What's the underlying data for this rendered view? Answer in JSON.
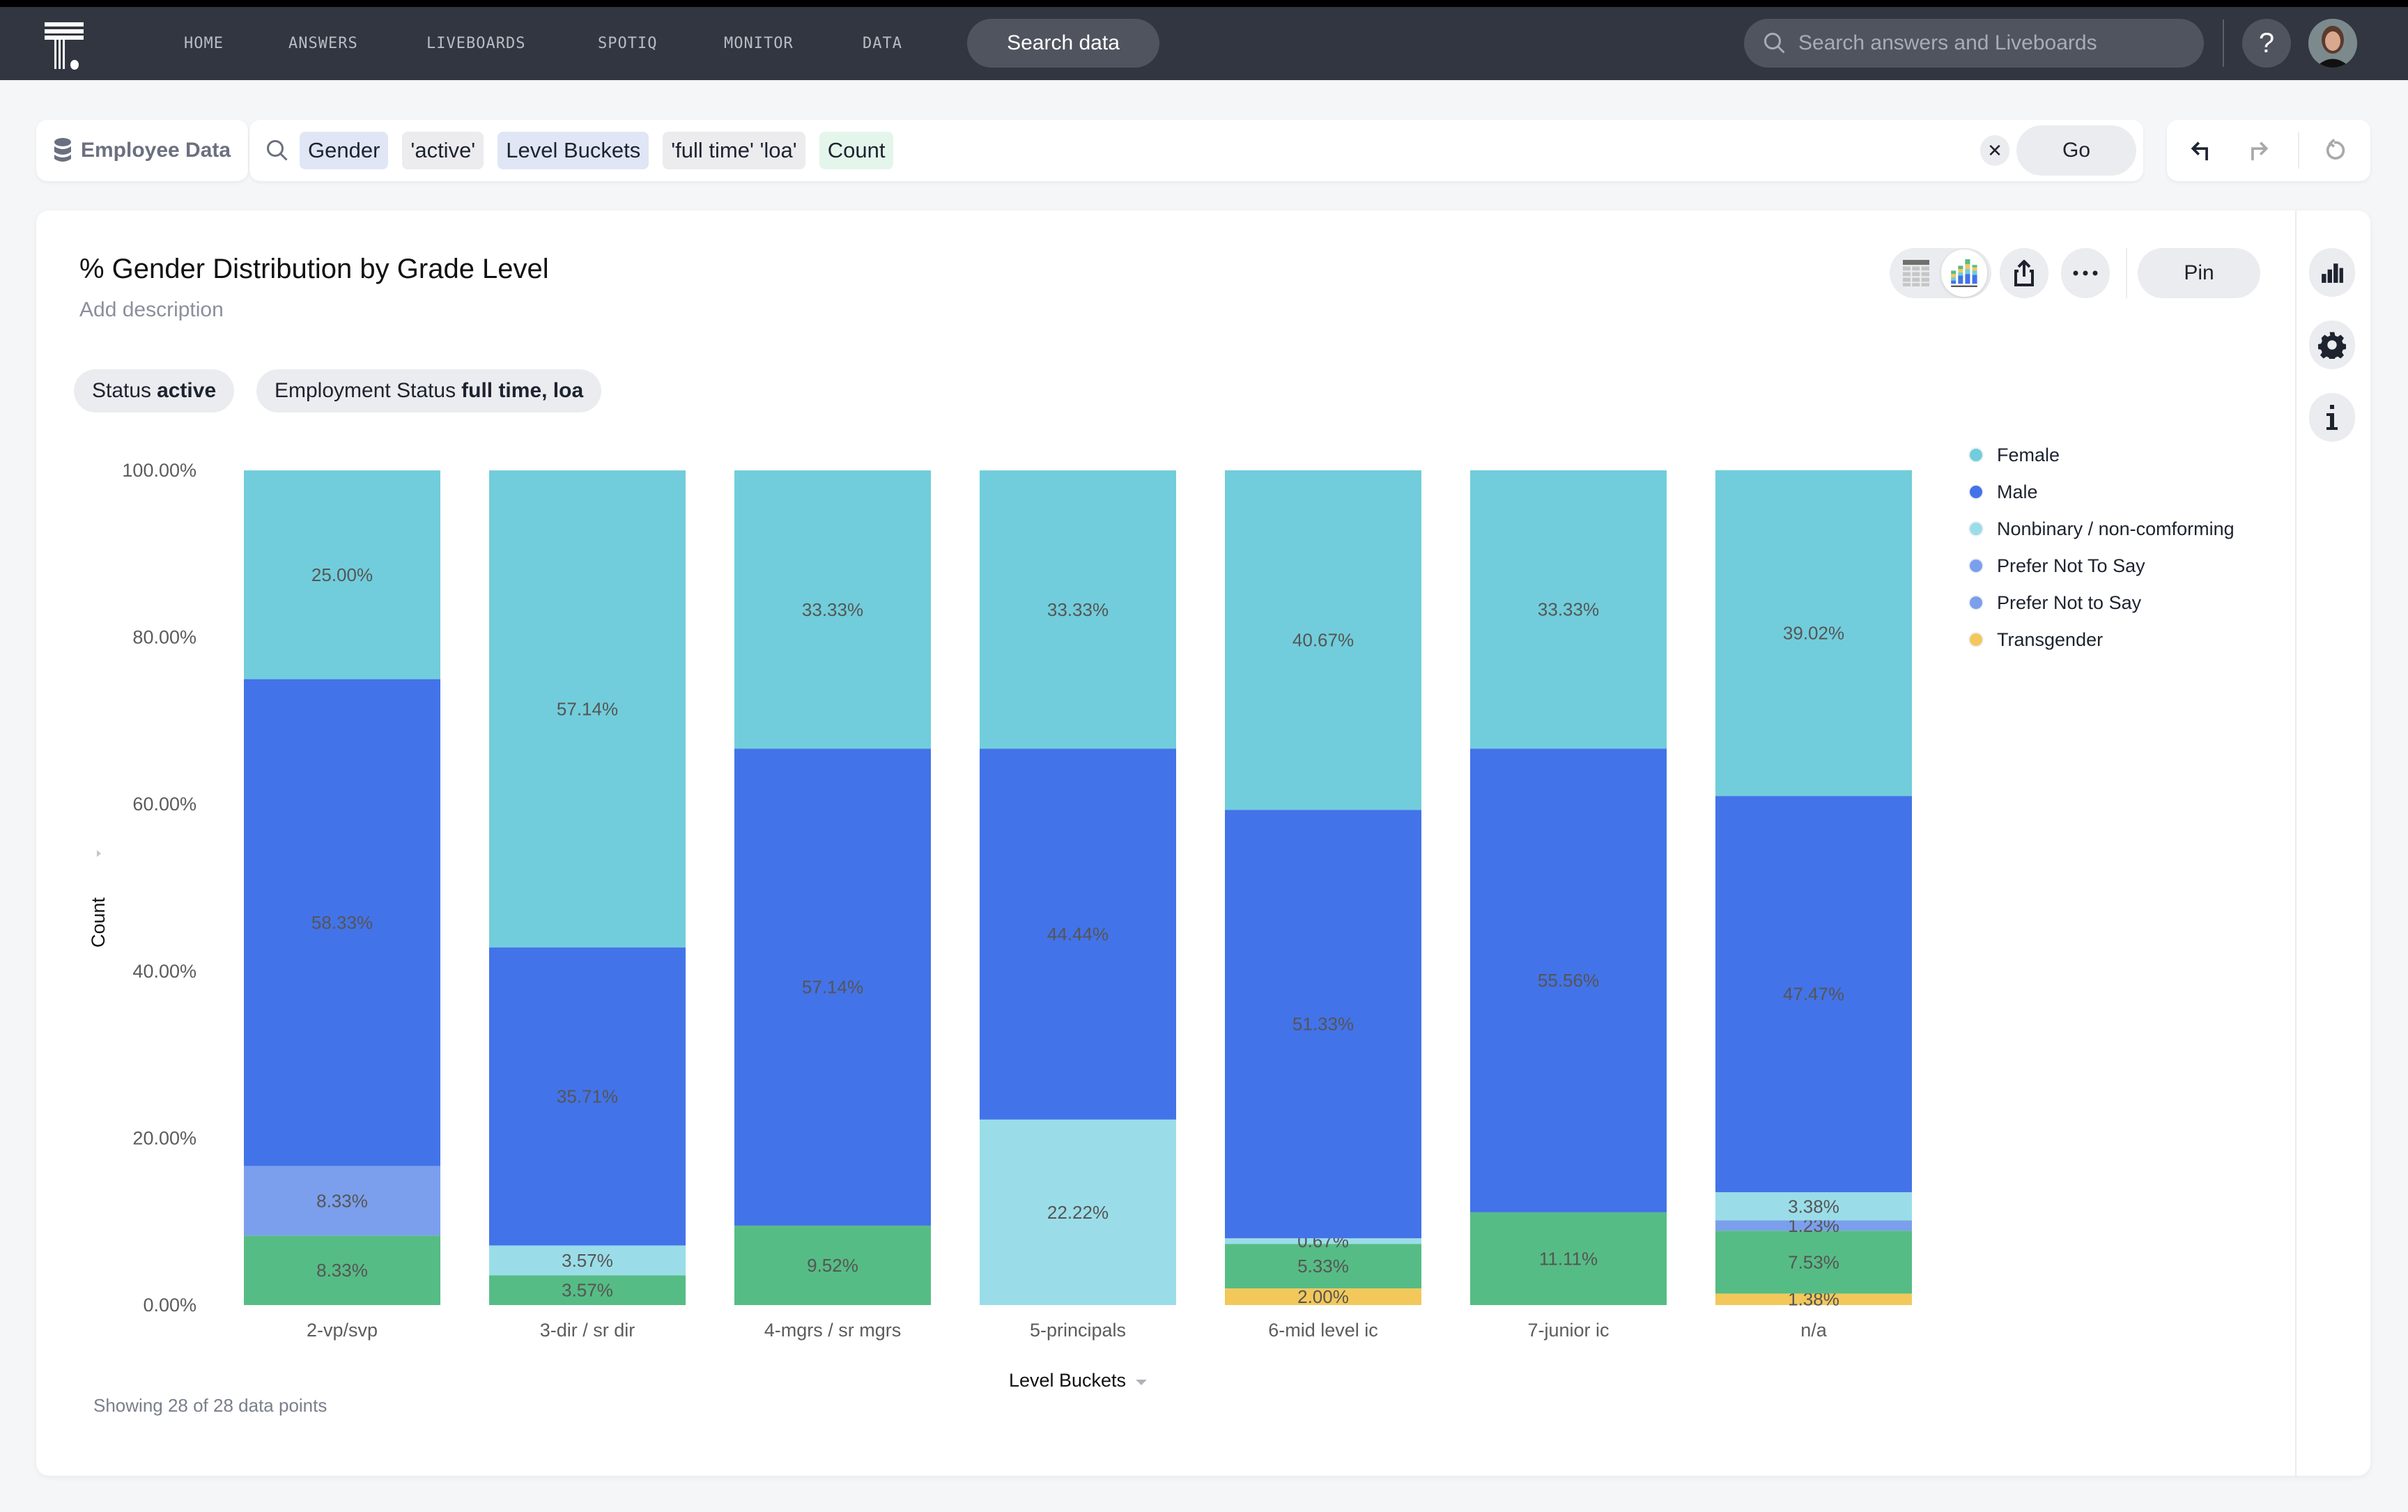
{
  "nav": {
    "items": [
      "HOME",
      "ANSWERS",
      "LIVEBOARDS",
      "SPOTIQ",
      "MONITOR",
      "DATA"
    ],
    "search_data_label": "Search data",
    "global_search_placeholder": "Search answers and Liveboards",
    "help_label": "?"
  },
  "search_bar": {
    "datasource": "Employee Data",
    "tokens": [
      {
        "text": "Gender",
        "kind": "attr"
      },
      {
        "text": "'active'",
        "kind": "val"
      },
      {
        "text": "Level Buckets",
        "kind": "attr"
      },
      {
        "text": "'full time' 'loa'",
        "kind": "val"
      },
      {
        "text": "Count",
        "kind": "measure"
      }
    ],
    "clear_label": "✕",
    "go_label": "Go"
  },
  "answer": {
    "title": "% Gender Distribution by Grade Level",
    "description_placeholder": "Add description",
    "filters": [
      {
        "name": "Status",
        "value": "active"
      },
      {
        "name": "Employment Status",
        "value": "full time, loa"
      }
    ],
    "pin_label": "Pin",
    "footer": "Showing 28 of 28 data points"
  },
  "chart_data": {
    "type": "bar",
    "stacked": "percent",
    "title": "% Gender Distribution by Grade Level",
    "xlabel": "Level Buckets",
    "ylabel": "Count",
    "ylim": [
      0,
      100
    ],
    "yticks": [
      "0.00%",
      "20.00%",
      "40.00%",
      "60.00%",
      "80.00%",
      "100.00%"
    ],
    "categories": [
      "2-vp/svp",
      "3-dir / sr dir",
      "4-mgrs / sr mgrs",
      "5-principals",
      "6-mid level ic",
      "7-junior ic",
      "n/a"
    ],
    "series": [
      {
        "name": "Transgender",
        "color": "#f2c85b",
        "values": [
          0,
          0,
          0,
          0,
          2.0,
          0,
          1.38
        ]
      },
      {
        "name": "Prefer Not to Say",
        "color": "#56bc85",
        "values": [
          8.33,
          3.57,
          9.52,
          0,
          5.33,
          11.11,
          7.53
        ]
      },
      {
        "name": "Prefer Not To Say",
        "color": "#7b9fec",
        "values": [
          8.33,
          0,
          0,
          0,
          0,
          0,
          1.23
        ]
      },
      {
        "name": "Nonbinary / non-comforming",
        "color": "#9adde8",
        "values": [
          0,
          3.57,
          0,
          22.22,
          0.67,
          0,
          3.38
        ]
      },
      {
        "name": "Male",
        "color": "#4373e8",
        "values": [
          58.33,
          35.71,
          57.14,
          44.44,
          51.33,
          55.56,
          47.47
        ]
      },
      {
        "name": "Female",
        "color": "#71cddb",
        "values": [
          25.0,
          57.14,
          33.33,
          33.33,
          40.67,
          33.33,
          39.02
        ]
      }
    ],
    "legend": {
      "position": "right",
      "items": [
        {
          "name": "Female",
          "color": "#71cddb"
        },
        {
          "name": "Male",
          "color": "#4373e8"
        },
        {
          "name": "Nonbinary / non-comforming",
          "color": "#9adde8"
        },
        {
          "name": "Prefer Not To Say",
          "color": "#7b9fec"
        },
        {
          "name": "Prefer Not to Say",
          "color": "#7b9fec"
        },
        {
          "name": "Transgender",
          "color": "#f2c85b"
        }
      ]
    }
  }
}
